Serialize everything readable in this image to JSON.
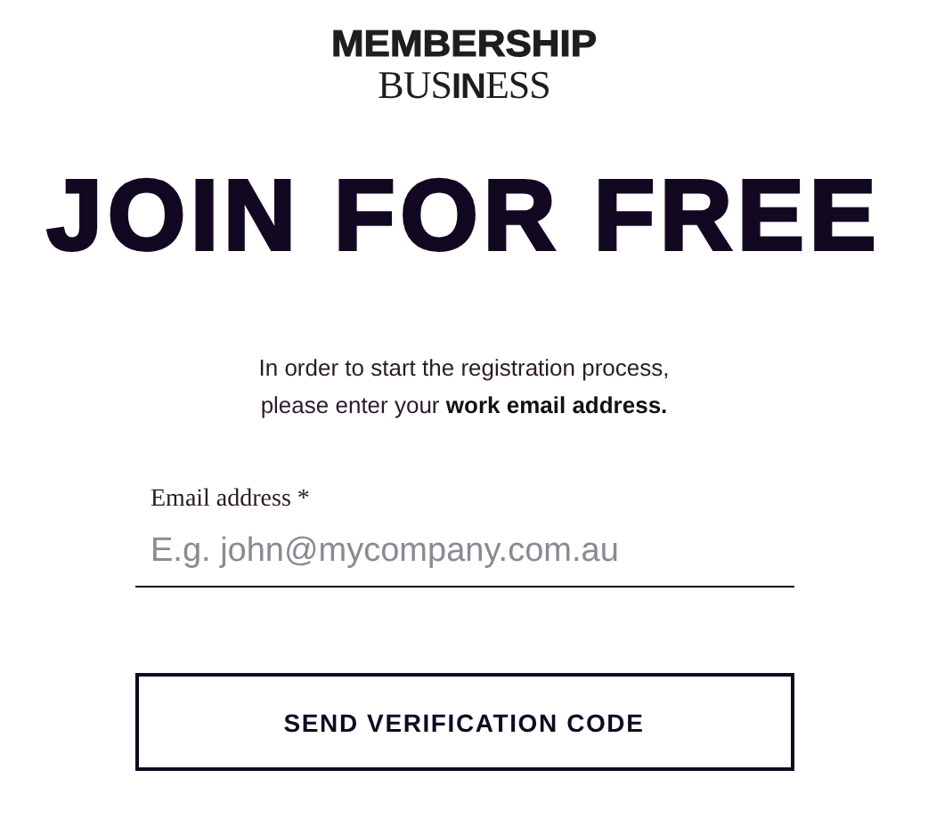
{
  "logo": {
    "line_1": "MEMBERSHIP",
    "line_2": "BUS**IN**ESS"
  },
  "heading": "JOIN FOR FREE",
  "intro": [
    "In order to start the registration process,",
    "please enter your **work email address.**"
  ],
  "email_field": {
    "label": "Email address *",
    "placeholder": "E.g. john@mycompany.com.au"
  },
  "button": "SEND VERIFICATION CODE"
}
